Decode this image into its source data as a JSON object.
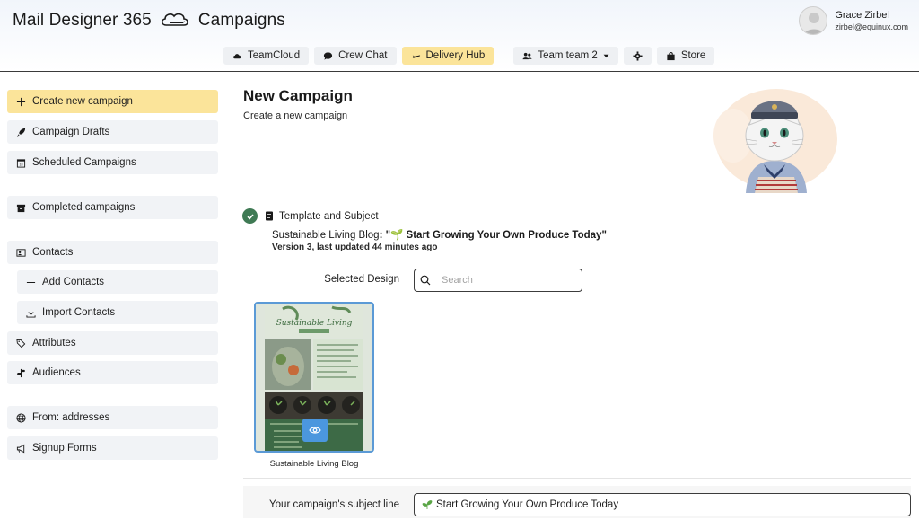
{
  "app": {
    "title_part1": "Mail Designer 365",
    "title_part2": "Campaigns"
  },
  "user": {
    "name": "Grace Zirbel",
    "email": "zirbel@equinux.com"
  },
  "toolbar": {
    "teamcloud": "TeamCloud",
    "crew_chat": "Crew Chat",
    "delivery_hub": "Delivery Hub",
    "team": "Team team 2",
    "store": "Store"
  },
  "sidebar": {
    "create": "Create new campaign",
    "drafts": "Campaign Drafts",
    "scheduled": "Scheduled Campaigns",
    "completed": "Completed campaigns",
    "contacts": "Contacts",
    "add_contacts": "Add Contacts",
    "import_contacts": "Import Contacts",
    "attributes": "Attributes",
    "audiences": "Audiences",
    "from_addresses": "From: addresses",
    "signup_forms": "Signup Forms"
  },
  "main": {
    "title": "New Campaign",
    "subtitle": "Create a new campaign",
    "step_label": "Template and Subject",
    "template_name": "Sustainable Living Blog",
    "template_separator": ": ",
    "template_subject": "\"🌱 Start Growing Your Own Produce Today\"",
    "version_info": "Version 3, last updated 44 minutes ago",
    "selected_design_label": "Selected Design",
    "search_placeholder": "Search",
    "design_caption": "Sustainable Living Blog",
    "thumb_title": "Sustainable Living",
    "subject_label": "Your campaign's subject line",
    "subject_value": "Start Growing Your Own Produce Today"
  },
  "colors": {
    "accent": "#fbe49a",
    "check": "#3f7a54",
    "selection": "#5b9ad6"
  }
}
